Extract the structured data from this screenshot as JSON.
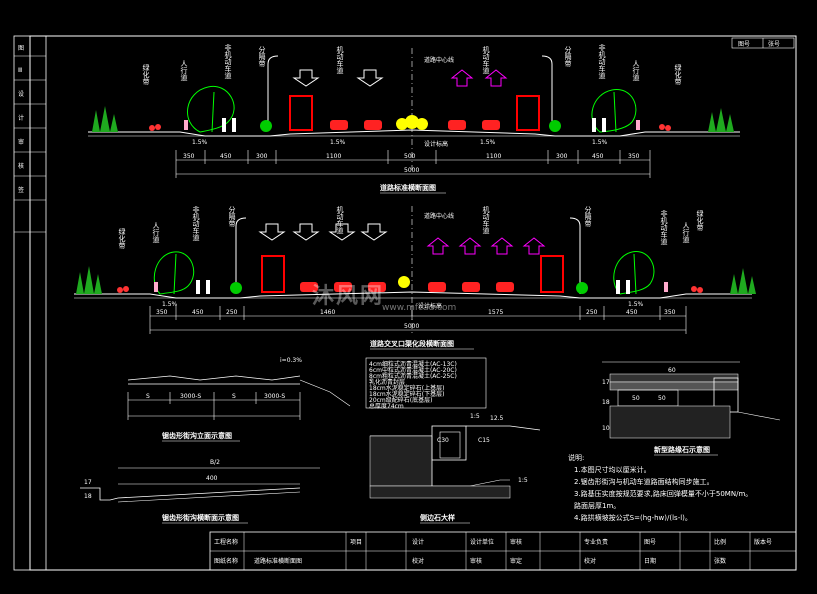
{
  "drawing": {
    "section1_title": "道路标准横断面图",
    "section2_title": "道路交叉口渠化段横断面图",
    "detail_curb_title": "侧边石大样",
    "detail_sidewalk_title": "新型路缘石示意图",
    "detail_cross_title": "锯齿形街沟立面示意图",
    "detail_gutter_title": "锯齿形街沟横断面示意图",
    "section1": {
      "labels_left": [
        "绿化带",
        "人行道",
        "非机动车道",
        "分隔带",
        "机动车道"
      ],
      "labels_right": [
        "机动车道",
        "分隔带",
        "非机动车道",
        "人行道",
        "绿化带"
      ],
      "center_label": "道路中心线",
      "center_marker": "设计标高",
      "slope_left": "1.5%",
      "slope_mid_left": "1.5%",
      "slope_mid_right": "1.5%",
      "slope_right": "1.5%",
      "dims": [
        "350",
        "450",
        "300",
        "1100",
        "500",
        "1100",
        "300",
        "450",
        "350"
      ],
      "total": "5000"
    },
    "section2": {
      "labels_left": [
        "绿化带",
        "人行道",
        "非机动车道",
        "分隔带",
        "机动车道"
      ],
      "labels_right": [
        "机动车道",
        "分隔带",
        "非机动车道",
        "人行道",
        "绿化带"
      ],
      "center_label": "道路中心线",
      "center_marker": "设计标高",
      "slope_left": "1.5%",
      "slope_right": "1.5%",
      "dims": [
        "350",
        "450",
        "250",
        "1460",
        "1575",
        "250",
        "450",
        "350"
      ],
      "total": "5000"
    },
    "cross_dims": [
      "S",
      "3000-S",
      "S",
      "3000-S"
    ],
    "cross_top": "i=0.3%",
    "gutter_dims": [
      "B/2",
      "400",
      "17",
      "18"
    ],
    "pavement_layers": [
      "4cm细粒式沥青混凝土(AC-13C)",
      "6cm中粒式沥青混凝土(AC-20C)",
      "8cm粗粒式沥青混凝土(AC-25C)",
      "乳化沥青封层",
      "18cm水泥稳定碎石(上基层)",
      "18cm水泥稳定碎石(下基层)",
      "20cm级配碎石(底基层)",
      "总厚度74cm"
    ],
    "curb_labels": [
      "C30",
      "C15",
      "1:5",
      "12.5",
      "1:5"
    ],
    "sidewalk_dims": [
      "60",
      "50",
      "50",
      "17",
      "18",
      "10"
    ],
    "notes_title": "说明:",
    "notes": [
      "1.本图尺寸均以厘米计。",
      "2.锯齿形街沟与机动车道路面结构同步施工。",
      "3.路基压实度按规范要求,路床回弹模量不小于50MN/m。",
      "   路面层厚1m。",
      "4.路拱横坡按公式S=(hg-hw)/(ls-l)。"
    ],
    "titleblock": {
      "project_name_label": "工程名称",
      "drawing_name_label": "图纸名称",
      "drawing_name": "道路标准横断面图",
      "item_label": "项目",
      "design": "设计",
      "check": "校对",
      "review": "审核",
      "approve": "审定",
      "cells": [
        "设计单位",
        "审核",
        "专业负责",
        "校对",
        "图号",
        "日期",
        "比例",
        "张数"
      ],
      "sheet_no": "版本号"
    },
    "top_right": [
      "图号",
      "张号"
    ],
    "left_strip": [
      "图",
      "Ⅲ",
      "设",
      "计",
      "审",
      "核",
      "签"
    ]
  },
  "watermark": "沐风网",
  "watermark_url": "www.mfcad.com",
  "colors": {
    "bg": "#000000",
    "line": "#ffffff",
    "truck": "#ff0000",
    "arrow_left": "#ffffff",
    "arrow_right": "#ff00ff",
    "tree": "#00ff00",
    "flower": "#ff3333",
    "yellow": "#ffff00"
  }
}
